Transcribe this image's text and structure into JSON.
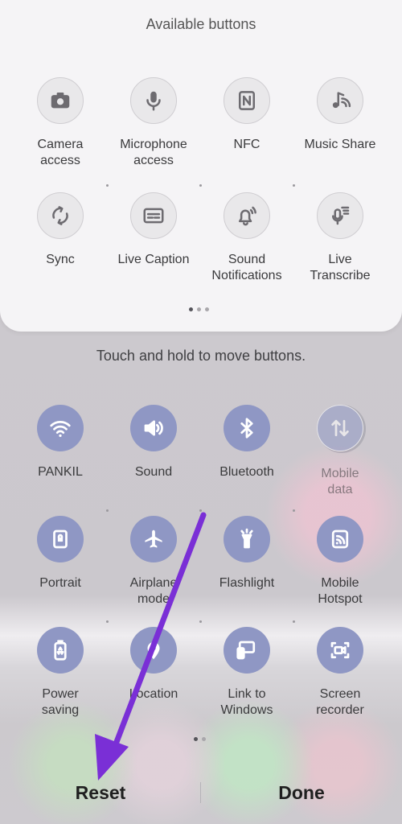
{
  "available": {
    "title": "Available buttons",
    "buttons": [
      {
        "label": "Camera\naccess",
        "icon": "camera-icon"
      },
      {
        "label": "Microphone\naccess",
        "icon": "microphone-icon"
      },
      {
        "label": "NFC",
        "icon": "nfc-icon"
      },
      {
        "label": "Music Share",
        "icon": "music-share-icon"
      },
      {
        "label": "Sync",
        "icon": "sync-icon"
      },
      {
        "label": "Live Caption",
        "icon": "live-caption-icon"
      },
      {
        "label": "Sound\nNotifications",
        "icon": "sound-notifications-icon"
      },
      {
        "label": "Live\nTranscribe",
        "icon": "live-transcribe-icon"
      }
    ]
  },
  "hint": "Touch and hold to move buttons.",
  "active": {
    "buttons": [
      {
        "label": "PANKIL",
        "icon": "wifi-icon"
      },
      {
        "label": "Sound",
        "icon": "sound-icon"
      },
      {
        "label": "Bluetooth",
        "icon": "bluetooth-icon"
      },
      {
        "label": "Mobile\ndata",
        "icon": "mobile-data-icon"
      },
      {
        "label": "Portrait",
        "icon": "portrait-icon"
      },
      {
        "label": "Airplane\nmode",
        "icon": "airplane-icon"
      },
      {
        "label": "Flashlight",
        "icon": "flashlight-icon"
      },
      {
        "label": "Mobile\nHotspot",
        "icon": "mobile-hotspot-icon"
      },
      {
        "label": "Power\nsaving",
        "icon": "power-saving-icon"
      },
      {
        "label": "Location",
        "icon": "location-icon"
      },
      {
        "label": "Link to\nWindows",
        "icon": "link-to-windows-icon"
      },
      {
        "label": "Screen\nrecorder",
        "icon": "screen-recorder-icon"
      }
    ]
  },
  "footer": {
    "reset": "Reset",
    "done": "Done"
  },
  "colors": {
    "active_tile": "#8f97c4",
    "arrow": "#7a2fd6"
  }
}
